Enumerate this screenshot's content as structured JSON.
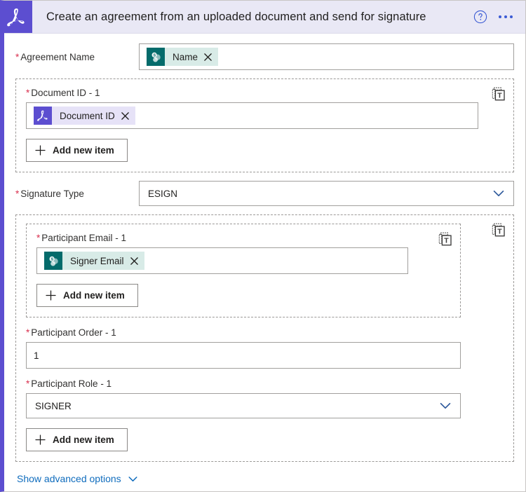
{
  "header": {
    "brand_icon": "adobe-acrobat-icon",
    "title": "Create an agreement from an uploaded document and send for signature",
    "help_icon": "help-circle-icon",
    "more_icon": "more-horizontal-icon"
  },
  "colors": {
    "brand_purple": "#5c4ed0",
    "header_bg": "#e9e8f5",
    "sharepoint_teal": "#046b6b",
    "sharepoint_chip": "#d8ebe7",
    "adobe_chip": "#e6e2f7",
    "required_red": "#d9304f",
    "link_blue": "#0f6cbd",
    "chevron_blue": "#2b579a"
  },
  "fields": {
    "agreement_name": {
      "label": "Agreement Name",
      "required": true,
      "token": {
        "text": "Name",
        "icon": "sharepoint-icon",
        "remove_icon": "close-icon"
      }
    },
    "document_id": {
      "label": "Document ID - 1",
      "required": true,
      "array_tool_icon": "switch-to-text-mode-icon",
      "token": {
        "text": "Document ID",
        "icon": "adobe-acrobat-icon",
        "remove_icon": "close-icon"
      },
      "add_item_label": "Add new item",
      "add_item_icon": "plus-icon"
    },
    "signature_type": {
      "label": "Signature Type",
      "required": true,
      "value": "ESIGN",
      "chevron_icon": "chevron-down-icon"
    },
    "participant_email": {
      "label": "Participant Email - 1",
      "required": true,
      "array_tool_icon": "switch-to-text-mode-icon",
      "token": {
        "text": "Signer Email",
        "icon": "sharepoint-icon",
        "remove_icon": "close-icon"
      },
      "add_item_label": "Add new item",
      "add_item_icon": "plus-icon"
    },
    "participant_order": {
      "label": "Participant Order - 1",
      "required": true,
      "value": "1"
    },
    "participant_role": {
      "label": "Participant Role - 1",
      "required": true,
      "value": "SIGNER",
      "chevron_icon": "chevron-down-icon"
    },
    "participants_array": {
      "array_tool_icon": "switch-to-text-mode-icon",
      "add_item_label": "Add new item",
      "add_item_icon": "plus-icon"
    }
  },
  "footer": {
    "advanced_label": "Show advanced options",
    "advanced_icon": "chevron-down-icon"
  }
}
